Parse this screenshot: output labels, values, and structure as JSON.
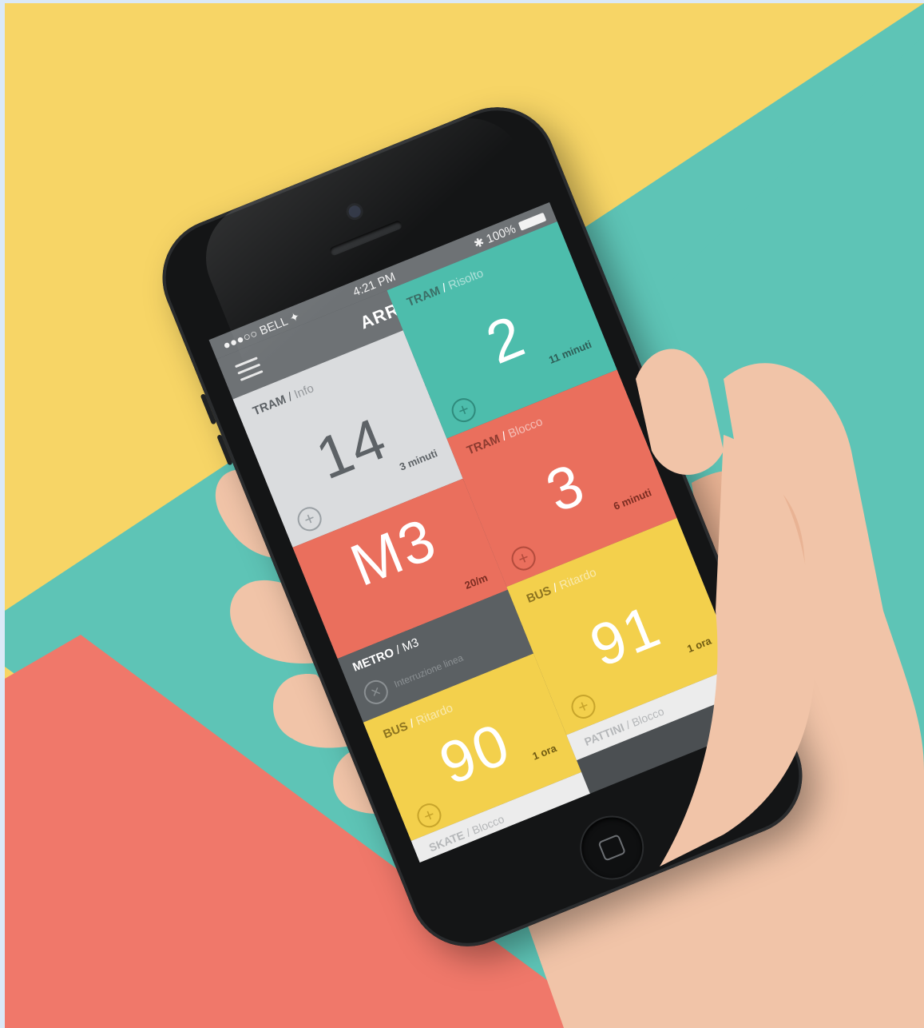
{
  "colors": {
    "yellow": "#f7d566",
    "teal": "#5ec4b6",
    "coral": "#f0786a",
    "phone": "#141516"
  },
  "status": {
    "carrier": "●●●○○ BELL ✦",
    "time": "4:21 PM",
    "battery": "✱ 100%"
  },
  "app": {
    "title": "ARRIVO"
  },
  "tiles": [
    {
      "type": "TRAM",
      "sub": "Info",
      "number": "14",
      "eta": "3 minuti"
    },
    {
      "type": "TRAM",
      "sub": "Risolto",
      "number": "2",
      "eta": "11 minuti"
    },
    {
      "type": "METRO",
      "sub": "",
      "number": "M3",
      "eta": "20/m"
    },
    {
      "type": "TRAM",
      "sub": "Blocco",
      "number": "3",
      "eta": "6 minuti"
    },
    {
      "type": "BUS",
      "sub": "Ritardo",
      "number": "90",
      "eta": "1 ora"
    },
    {
      "type": "BUS",
      "sub": "Ritardo",
      "number": "91",
      "eta": "1 ora"
    }
  ],
  "metro_bar": {
    "type": "METRO",
    "sub": "M3",
    "detail": "Interruzione linea"
  },
  "footers": [
    {
      "type": "SKATE",
      "sub": "Blocco"
    },
    {
      "type": "PATTINI",
      "sub": "Blocco"
    }
  ],
  "icons": {
    "menu": "hamburger-icon",
    "message": "message-icon",
    "add": "plus-circle-icon",
    "close": "close-circle-icon",
    "home": "home-button-icon"
  }
}
